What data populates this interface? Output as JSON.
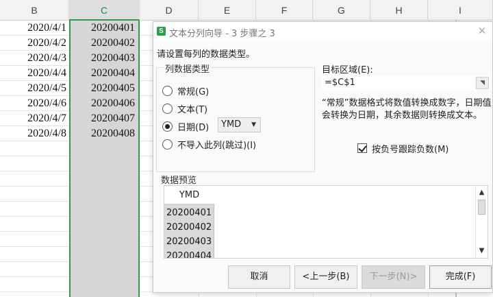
{
  "sheet": {
    "columns": [
      "B",
      "C",
      "D",
      "E",
      "F",
      "G",
      "H",
      "I"
    ],
    "selected_column": "C",
    "col_b": [
      "2020/4/1",
      "2020/4/2",
      "2020/4/3",
      "2020/4/4",
      "2020/4/5",
      "2020/4/6",
      "2020/4/7",
      "2020/4/8"
    ],
    "col_c": [
      "20200401",
      "20200402",
      "20200403",
      "20200404",
      "20200405",
      "20200406",
      "20200407",
      "20200408"
    ]
  },
  "dialog": {
    "app_icon_letter": "S",
    "title": "文本分列向导 - 3 步骤之 3",
    "close_icon": "✕",
    "instruction": "请设置每列的数据类型。",
    "column_type_legend": "列数据类型",
    "radio_general": "常规(G)",
    "radio_text": "文本(T)",
    "radio_date": "日期(D)",
    "radio_skip": "不导入此列(跳过)(I)",
    "selected_type": "date",
    "date_format": "YMD",
    "dropdown_icon": "▼",
    "target_label": "目标区域(E):",
    "target_value": "=$C$1",
    "range_picker_icon": "◥",
    "description": "“常规”数据格式将数值转换成数字，日期值会转换为日期，其余数据则转换成文本。",
    "neg_checkbox_label": "按负号跟踪负数(M)",
    "neg_checked": true,
    "preview_legend": "数据预览",
    "preview_header": "YMD",
    "preview_rows": [
      "20200401",
      "20200402",
      "20200403",
      "20200404"
    ],
    "scroll_up_icon": "▲",
    "scroll_down_icon": "▼",
    "btn_cancel": "取消",
    "btn_prev": "<上一步(B)",
    "btn_next": "下一步(N)>",
    "btn_finish": "完成(F)"
  },
  "colors": {
    "accent_green": "#2e9a4a",
    "selected_column_fill": "#d6d6d6"
  }
}
